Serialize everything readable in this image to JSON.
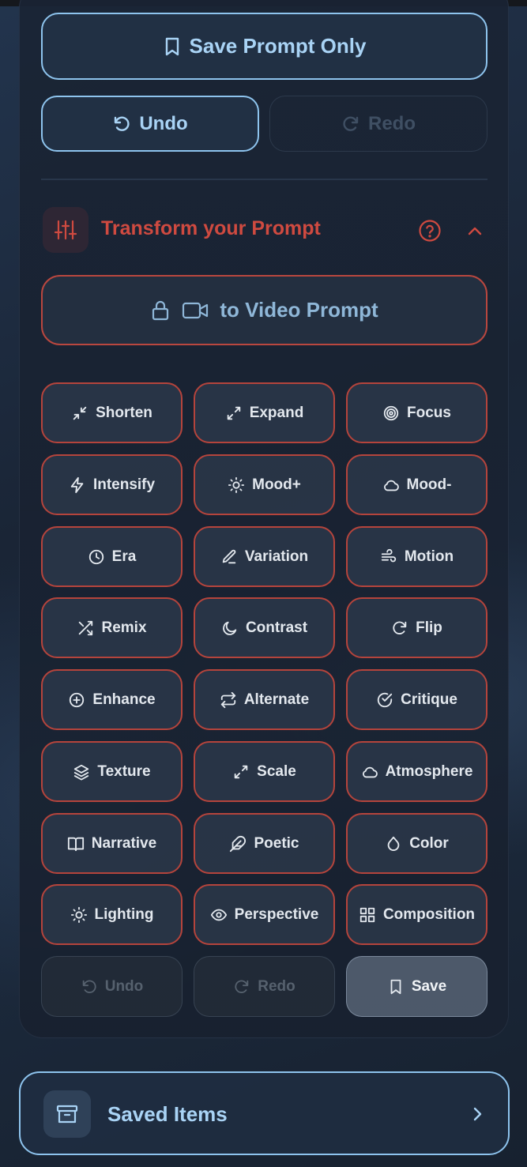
{
  "top": {
    "save_prompt_label": "Save Prompt Only",
    "undo_label": "Undo",
    "redo_label": "Redo"
  },
  "transform": {
    "title": "Transform your Prompt",
    "video_label": "to Video Prompt",
    "buttons": [
      {
        "label": "Shorten",
        "icon": "shrink-icon"
      },
      {
        "label": "Expand",
        "icon": "expand-icon"
      },
      {
        "label": "Focus",
        "icon": "target-icon"
      },
      {
        "label": "Intensify",
        "icon": "bolt-icon"
      },
      {
        "label": "Mood+",
        "icon": "sun-icon"
      },
      {
        "label": "Mood-",
        "icon": "cloud-icon"
      },
      {
        "label": "Era",
        "icon": "clock-icon"
      },
      {
        "label": "Variation",
        "icon": "pen-icon"
      },
      {
        "label": "Motion",
        "icon": "wind-icon"
      },
      {
        "label": "Remix",
        "icon": "shuffle-icon"
      },
      {
        "label": "Contrast",
        "icon": "moon-icon"
      },
      {
        "label": "Flip",
        "icon": "rotate-icon"
      },
      {
        "label": "Enhance",
        "icon": "plus-circle-icon"
      },
      {
        "label": "Alternate",
        "icon": "repeat-icon"
      },
      {
        "label": "Critique",
        "icon": "check-circle-icon"
      },
      {
        "label": "Texture",
        "icon": "layers-icon"
      },
      {
        "label": "Scale",
        "icon": "scale-icon"
      },
      {
        "label": "Atmosphere",
        "icon": "cloud-icon"
      },
      {
        "label": "Narrative",
        "icon": "book-icon"
      },
      {
        "label": "Poetic",
        "icon": "feather-icon"
      },
      {
        "label": "Color",
        "icon": "droplet-icon"
      },
      {
        "label": "Lighting",
        "icon": "sun-icon"
      },
      {
        "label": "Perspective",
        "icon": "eye-icon"
      },
      {
        "label": "Composition",
        "icon": "grid-icon"
      }
    ],
    "bottom_undo": "Undo",
    "bottom_redo": "Redo",
    "bottom_save": "Save"
  },
  "saved_items": {
    "label": "Saved Items"
  },
  "colors": {
    "accent_red": "#cf4a40",
    "accent_blue": "#a9d3f5",
    "border_red": "#b5443c"
  }
}
